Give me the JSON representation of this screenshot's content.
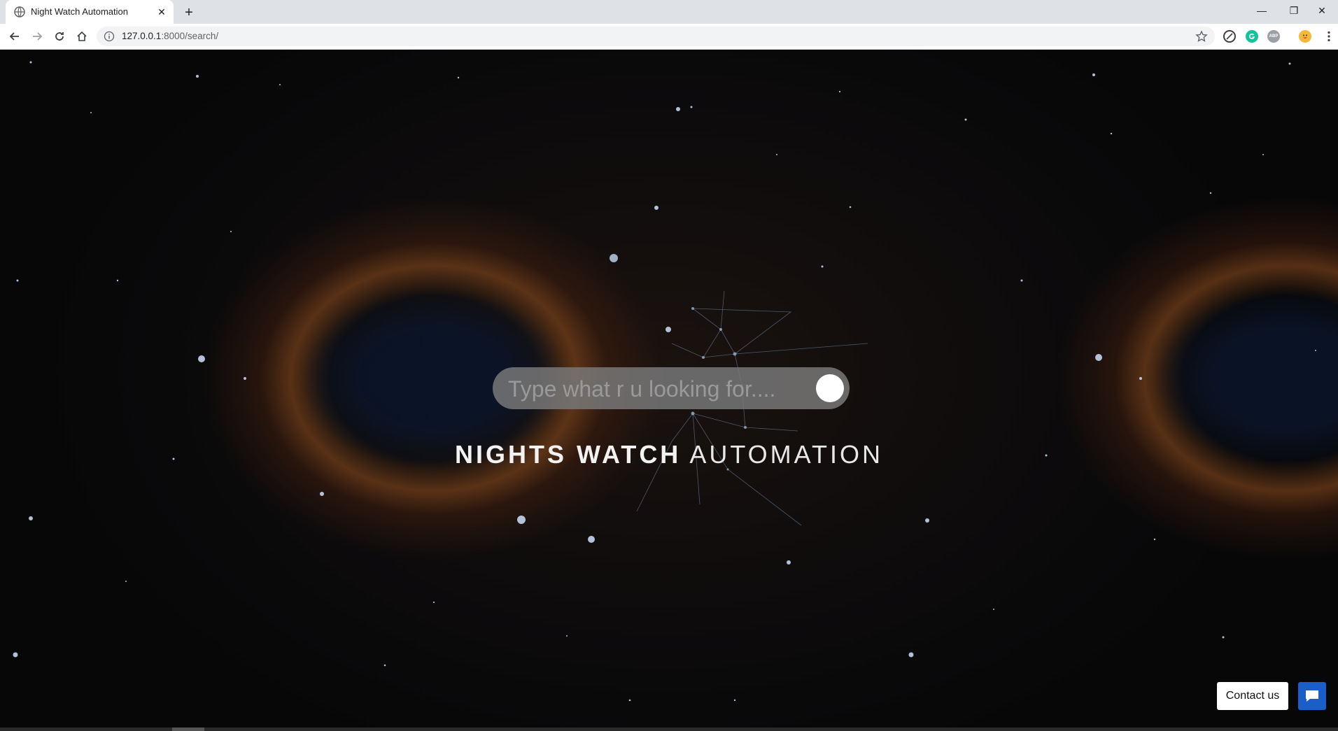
{
  "browser": {
    "tab_title": "Night Watch Automation",
    "tab_close": "✕",
    "new_tab": "+",
    "url_host": "127.0.0.1",
    "url_rest": ":8000/search/",
    "window_minimize": "—",
    "window_restore": "❐",
    "window_close": "✕",
    "extension_abp_label": "ABP"
  },
  "page": {
    "search": {
      "placeholder": "Type what r u looking for....",
      "value": ""
    },
    "brand_strong": "NIGHTS WATCH",
    "brand_light": "AUTOMATION",
    "contact_label": "Contact us"
  },
  "icons": {
    "back": "back-arrow-icon",
    "forward": "forward-arrow-icon",
    "reload": "reload-icon",
    "home": "home-icon",
    "info": "info-icon",
    "star": "bookmark-star-icon",
    "chat": "chat-icon"
  },
  "colors": {
    "chat_button": "#1a5fc9",
    "search_pill": "#787878",
    "tab_bar": "#dee1e6"
  }
}
